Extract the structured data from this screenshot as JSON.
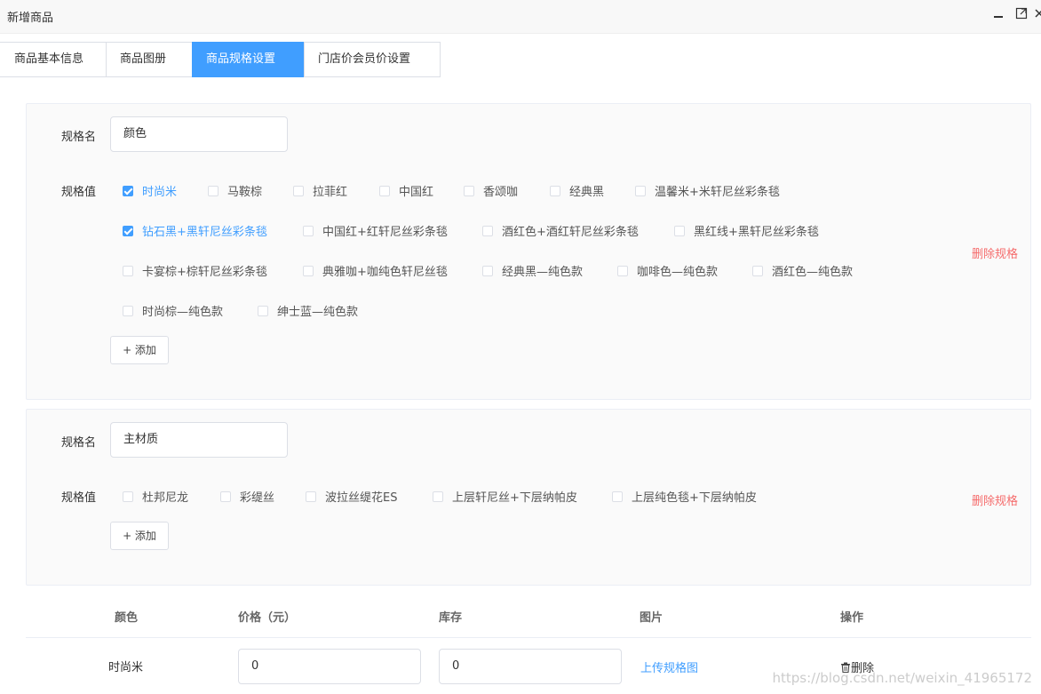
{
  "window": {
    "title": "新增商品",
    "minimize_icon": "minimize-icon",
    "maximize_icon": "maximize-icon",
    "close_icon": "close-icon"
  },
  "tabs": [
    {
      "label": "商品基本信息",
      "active": false
    },
    {
      "label": "商品图册",
      "active": false
    },
    {
      "label": "商品规格设置",
      "active": true
    },
    {
      "label": "门店价会员价设置",
      "active": false
    }
  ],
  "specs": [
    {
      "name_label": "规格名",
      "name_value": "颜色",
      "values_label": "规格值",
      "values": [
        {
          "label": "时尚米",
          "checked": true
        },
        {
          "label": "马鞍棕",
          "checked": false
        },
        {
          "label": "拉菲红",
          "checked": false
        },
        {
          "label": "中国红",
          "checked": false
        },
        {
          "label": "香颂咖",
          "checked": false
        },
        {
          "label": "经典黑",
          "checked": false
        },
        {
          "label": "温馨米+米轩尼丝彩条毯",
          "checked": false
        },
        {
          "label": "钻石黑+黑轩尼丝彩条毯",
          "checked": true
        },
        {
          "label": "中国红+红轩尼丝彩条毯",
          "checked": false
        },
        {
          "label": "酒红色+酒红轩尼丝彩条毯",
          "checked": false
        },
        {
          "label": "黑红线+黑轩尼丝彩条毯",
          "checked": false
        },
        {
          "label": "卡宴棕+棕轩尼丝彩条毯",
          "checked": false
        },
        {
          "label": "典雅咖+咖纯色轩尼丝毯",
          "checked": false
        },
        {
          "label": "经典黑—纯色款",
          "checked": false
        },
        {
          "label": "咖啡色—纯色款",
          "checked": false
        },
        {
          "label": "酒红色—纯色款",
          "checked": false
        },
        {
          "label": "时尚棕—纯色款",
          "checked": false
        },
        {
          "label": "绅士蓝—纯色款",
          "checked": false
        }
      ],
      "add_label": "+ 添加",
      "delete_label": "删除规格"
    },
    {
      "name_label": "规格名",
      "name_value": "主材质",
      "values_label": "规格值",
      "values": [
        {
          "label": "杜邦尼龙",
          "checked": false
        },
        {
          "label": "彩缇丝",
          "checked": false
        },
        {
          "label": "波拉丝缇花ES",
          "checked": false
        },
        {
          "label": "上层轩尼丝+下层纳帕皮",
          "checked": false
        },
        {
          "label": "上层纯色毯+下层纳帕皮",
          "checked": false
        }
      ],
      "add_label": "+ 添加",
      "delete_label": "删除规格"
    }
  ],
  "table": {
    "headers": [
      "颜色",
      "价格（元）",
      "库存",
      "图片",
      "操作"
    ],
    "rows": [
      {
        "color": "时尚米",
        "price": "0",
        "stock": "0",
        "image_link": "上传规格图",
        "delete_label": "删除",
        "delete_icon": "trash-icon"
      }
    ]
  },
  "watermark": "https://blog.csdn.net/weixin_41965172",
  "colors": {
    "accent": "#409eff",
    "danger": "#f56c6c"
  }
}
